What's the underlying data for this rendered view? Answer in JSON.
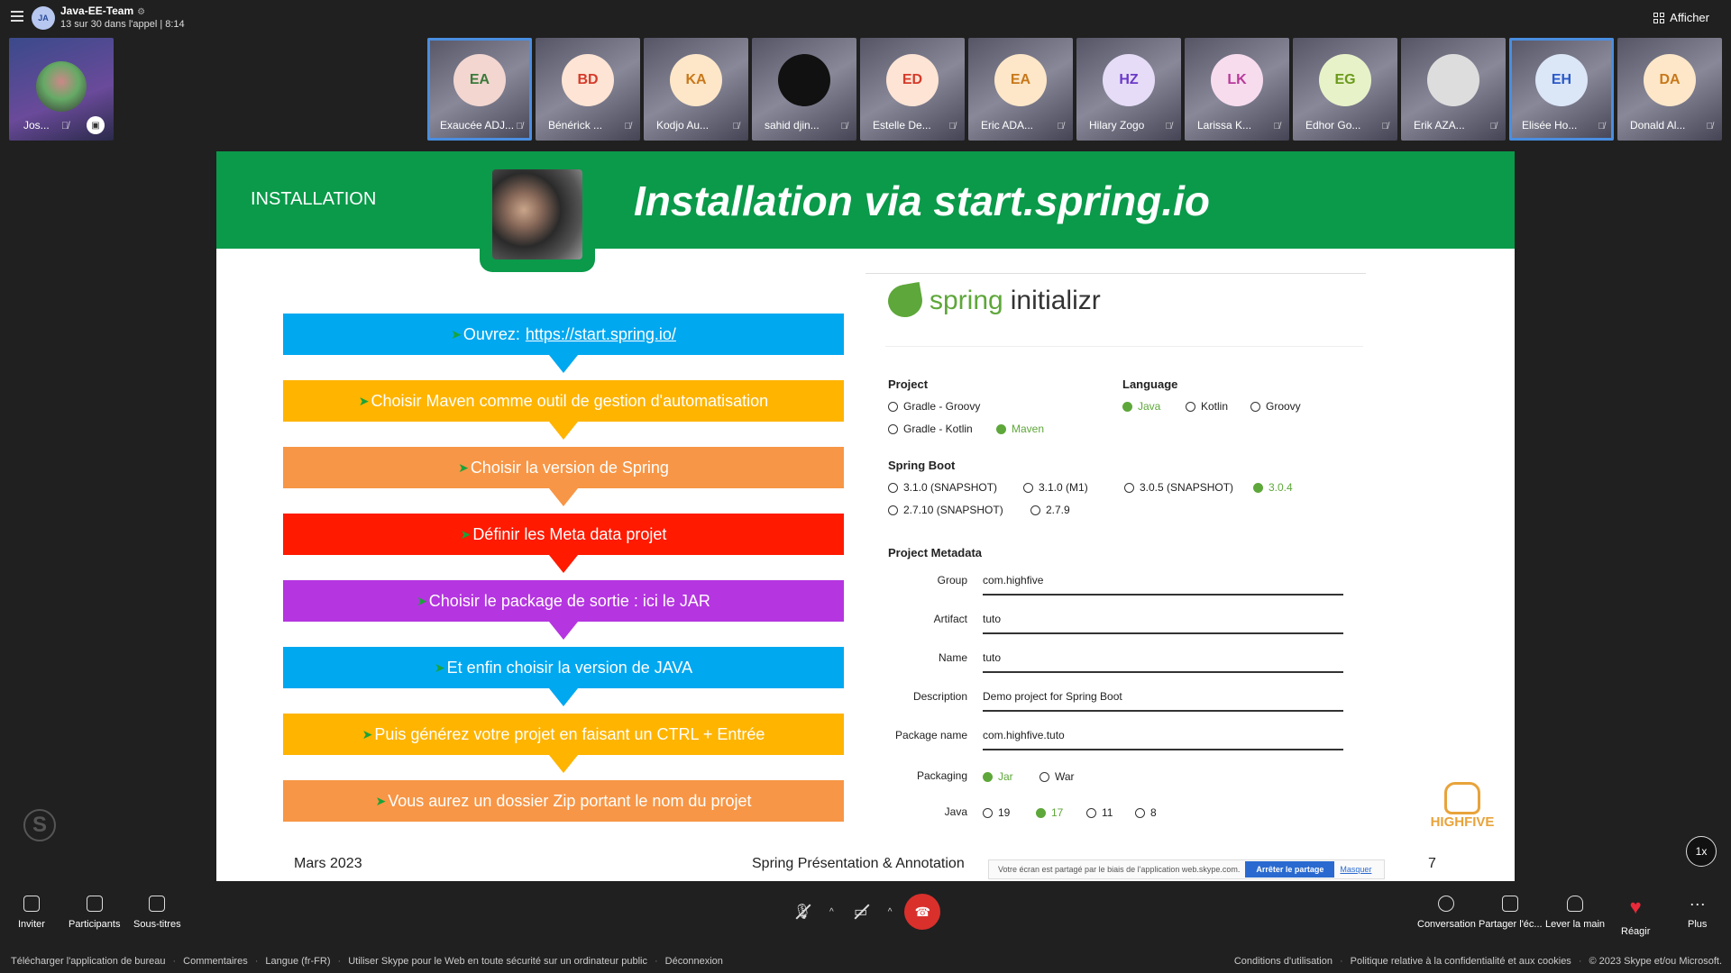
{
  "conversation": {
    "initials": "JA",
    "title": "Java-EE-Team",
    "subtitle": "13 sur 30 dans l'appel | 8:14",
    "view_button": "Afficher"
  },
  "self_view": {
    "name": "Jos..."
  },
  "participants": [
    {
      "initials": "EA",
      "name": "Exaucée ADJ...",
      "bg": "#f3d6d0",
      "fg": "#3a7a3a",
      "active": true
    },
    {
      "initials": "BD",
      "name": "Bénérick ...",
      "bg": "#fde4d4",
      "fg": "#d63a2a",
      "active": false
    },
    {
      "initials": "KA",
      "name": "Kodjo Au...",
      "bg": "#fde7c8",
      "fg": "#c8781a",
      "active": false
    },
    {
      "initials": "",
      "name": "sahid djin...",
      "bg": "#111111",
      "fg": "#ffffff",
      "active": false
    },
    {
      "initials": "ED",
      "name": "Estelle De...",
      "bg": "#fde4d4",
      "fg": "#d63a2a",
      "active": false
    },
    {
      "initials": "EA",
      "name": "Eric ADA...",
      "bg": "#fde7c8",
      "fg": "#c8781a",
      "active": false
    },
    {
      "initials": "HZ",
      "name": "Hilary Zogo",
      "bg": "#e6dcf7",
      "fg": "#6a3ac8",
      "active": false
    },
    {
      "initials": "LK",
      "name": "Larissa K...",
      "bg": "#f7dcee",
      "fg": "#b83a9a",
      "active": false
    },
    {
      "initials": "EG",
      "name": "Edhor Go...",
      "bg": "#e8f2c8",
      "fg": "#6a9a1a",
      "active": false
    },
    {
      "initials": "",
      "name": "Erik AZA...",
      "bg": "#dddddd",
      "fg": "#333333",
      "active": false
    },
    {
      "initials": "EH",
      "name": "Elisée Ho...",
      "bg": "#dbe6f7",
      "fg": "#2a5ac8",
      "active": true
    },
    {
      "initials": "DA",
      "name": "Donald Al...",
      "bg": "#fde7c8",
      "fg": "#c8781a",
      "active": false
    }
  ],
  "slide": {
    "section": "INSTALLATION",
    "title": "Installation via start.spring.io",
    "steps": [
      {
        "text": "Ouvrez:",
        "link": "https://start.spring.io/",
        "color": "#00a8f0"
      },
      {
        "text": "Choisir Maven comme outil de gestion d'automatisation",
        "link": "",
        "color": "#ffb400"
      },
      {
        "text": "Choisir la version de Spring",
        "link": "",
        "color": "#f79646"
      },
      {
        "text": "Définir les Meta data projet",
        "link": "",
        "color": "#ff1a00"
      },
      {
        "text": "Choisir le package de sortie : ici le JAR",
        "link": "",
        "color": "#b535e0"
      },
      {
        "text": "Et enfin choisir la version de JAVA",
        "link": "",
        "color": "#00a8f0"
      },
      {
        "text": "Puis générez votre projet en faisant un CTRL + Entrée",
        "link": "",
        "color": "#ffb400"
      },
      {
        "text": "Vous aurez un dossier Zip portant le nom du projet",
        "link": "",
        "color": "#f79646"
      }
    ],
    "initializr": {
      "logo_spring": "spring",
      "logo_initializr": "initializr",
      "project_label": "Project",
      "project_options": [
        {
          "label": "Gradle - Groovy",
          "selected": false
        },
        {
          "label": "Gradle - Kotlin",
          "selected": false
        },
        {
          "label": "Maven",
          "selected": true
        }
      ],
      "language_label": "Language",
      "language_options": [
        {
          "label": "Java",
          "selected": true
        },
        {
          "label": "Kotlin",
          "selected": false
        },
        {
          "label": "Groovy",
          "selected": false
        }
      ],
      "boot_label": "Spring Boot",
      "boot_options": [
        {
          "label": "3.1.0 (SNAPSHOT)",
          "selected": false
        },
        {
          "label": "3.1.0 (M1)",
          "selected": false
        },
        {
          "label": "3.0.5 (SNAPSHOT)",
          "selected": false
        },
        {
          "label": "3.0.4",
          "selected": true
        },
        {
          "label": "2.7.10 (SNAPSHOT)",
          "selected": false
        },
        {
          "label": "2.7.9",
          "selected": false
        }
      ],
      "metadata_label": "Project Metadata",
      "fields": [
        {
          "label": "Group",
          "value": "com.highfive"
        },
        {
          "label": "Artifact",
          "value": "tuto"
        },
        {
          "label": "Name",
          "value": "tuto"
        },
        {
          "label": "Description",
          "value": "Demo project for Spring Boot"
        },
        {
          "label": "Package name",
          "value": "com.highfive.tuto"
        }
      ],
      "packaging_label": "Packaging",
      "packaging_options": [
        {
          "label": "Jar",
          "selected": true
        },
        {
          "label": "War",
          "selected": false
        }
      ],
      "java_label": "Java",
      "java_options": [
        {
          "label": "19",
          "selected": false
        },
        {
          "label": "17",
          "selected": true
        },
        {
          "label": "11",
          "selected": false
        },
        {
          "label": "8",
          "selected": false
        }
      ]
    },
    "footer_date": "Mars 2023",
    "footer_title": "Spring Présentation & Annotation",
    "page_number": "7",
    "brand": "HIGHFIVE"
  },
  "share_bar": {
    "message": "Votre écran est partagé par le biais de l'application web.skype.com.",
    "stop_button": "Arrêter le partage",
    "hide_link": "Masquer"
  },
  "speed_badge": "1x",
  "toolbar": {
    "invite": "Inviter",
    "participants": "Participants",
    "subtitles": "Sous-titres",
    "conversation": "Conversation",
    "share": "Partager l'éc...",
    "raise_hand": "Lever la main",
    "react": "Réagir",
    "more": "Plus"
  },
  "footer": {
    "left": [
      "Télécharger l'application de bureau",
      "Commentaires",
      "Langue (fr-FR)",
      "Utiliser Skype pour le Web en toute sécurité sur un ordinateur public",
      "Déconnexion"
    ],
    "right": [
      "Conditions d'utilisation",
      "Politique relative à la confidentialité et aux cookies",
      "© 2023 Skype et/ou Microsoft."
    ]
  }
}
